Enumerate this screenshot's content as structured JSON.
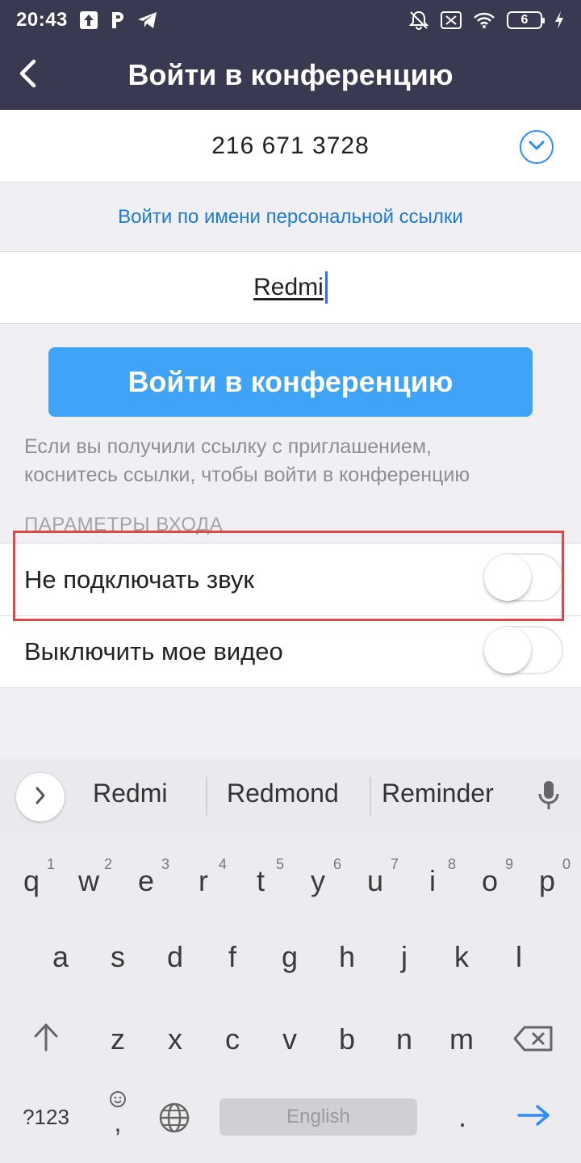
{
  "status_bar": {
    "time": "20:43",
    "battery_level": "6",
    "icons": [
      "upload-icon",
      "p-app-icon",
      "telegram-icon",
      "mute-icon",
      "sim-off-icon",
      "wifi-icon",
      "battery-icon",
      "charging-icon"
    ]
  },
  "header": {
    "title": "Войти в конференцию",
    "back_icon": "chevron-left-icon"
  },
  "meeting": {
    "id": "216 671 3728",
    "dropdown_icon": "chevron-down-circle-icon"
  },
  "personal_link": "Войти по имени персональной ссылки",
  "name_field": {
    "value": "Redmi"
  },
  "join_button": "Войти в конференцию",
  "hint_text": {
    "line1": "Если вы получили ссылку с приглашением,",
    "line2": "коснитесь ссылки, чтобы войти в конференцию"
  },
  "options": {
    "section_label": "ПАРАМЕТРЫ ВХОДА",
    "items": [
      {
        "label": "Не подключать звук",
        "enabled": false
      },
      {
        "label": "Выключить мое видео",
        "enabled": false
      }
    ]
  },
  "highlight_color": "#e04848",
  "accent_color": "#2d8cff",
  "keyboard": {
    "suggestions": [
      "Redmi",
      "Redmond",
      "Reminder"
    ],
    "row1": [
      {
        "key": "q",
        "num": "1"
      },
      {
        "key": "w",
        "num": "2"
      },
      {
        "key": "e",
        "num": "3"
      },
      {
        "key": "r",
        "num": "4"
      },
      {
        "key": "t",
        "num": "5"
      },
      {
        "key": "y",
        "num": "6"
      },
      {
        "key": "u",
        "num": "7"
      },
      {
        "key": "i",
        "num": "8"
      },
      {
        "key": "o",
        "num": "9"
      },
      {
        "key": "p",
        "num": "0"
      }
    ],
    "row2": [
      "a",
      "s",
      "d",
      "f",
      "g",
      "h",
      "j",
      "k",
      "l"
    ],
    "row3": [
      "z",
      "x",
      "c",
      "v",
      "b",
      "n",
      "m"
    ],
    "symbols_key": "?123",
    "comma_key": ",",
    "space_label": "English",
    "period_key": "."
  }
}
